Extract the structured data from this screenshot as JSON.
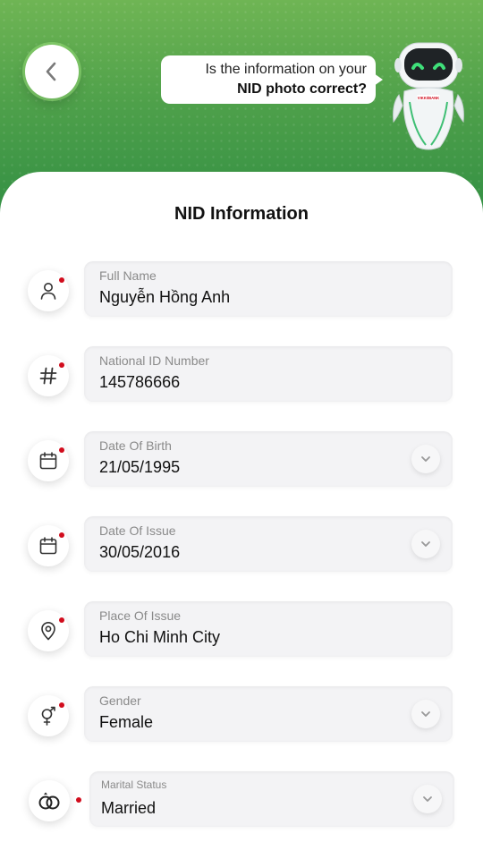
{
  "header": {
    "back_icon": "chevron-left-icon",
    "bubble_line1": "Is the information on your",
    "bubble_line2": "NID photo correct?",
    "robot_badge": "VIKKI/BANK"
  },
  "card": {
    "title": "NID Information",
    "fields": [
      {
        "label": "Full Name",
        "value": "Nguyễn Hồng Anh",
        "icon": "user-icon",
        "dropdown": false
      },
      {
        "label": "National ID Number",
        "value": "145786666",
        "icon": "hash-icon",
        "dropdown": false
      },
      {
        "label": "Date Of Birth",
        "value": "21/05/1995",
        "icon": "calendar-icon",
        "dropdown": true
      },
      {
        "label": "Date Of Issue",
        "value": "30/05/2016",
        "icon": "calendar-icon",
        "dropdown": true
      },
      {
        "label": "Place Of Issue",
        "value": "Ho Chi Minh City",
        "icon": "location-pin-icon",
        "dropdown": false
      },
      {
        "label": "Gender",
        "value": "Female",
        "icon": "gender-icon",
        "dropdown": true
      },
      {
        "label": "Marital Status",
        "value": "Married",
        "icon": "rings-icon",
        "dropdown": true
      }
    ]
  },
  "colors": {
    "brand_green": "#3f9a44",
    "required_dot": "#d10c1c"
  }
}
